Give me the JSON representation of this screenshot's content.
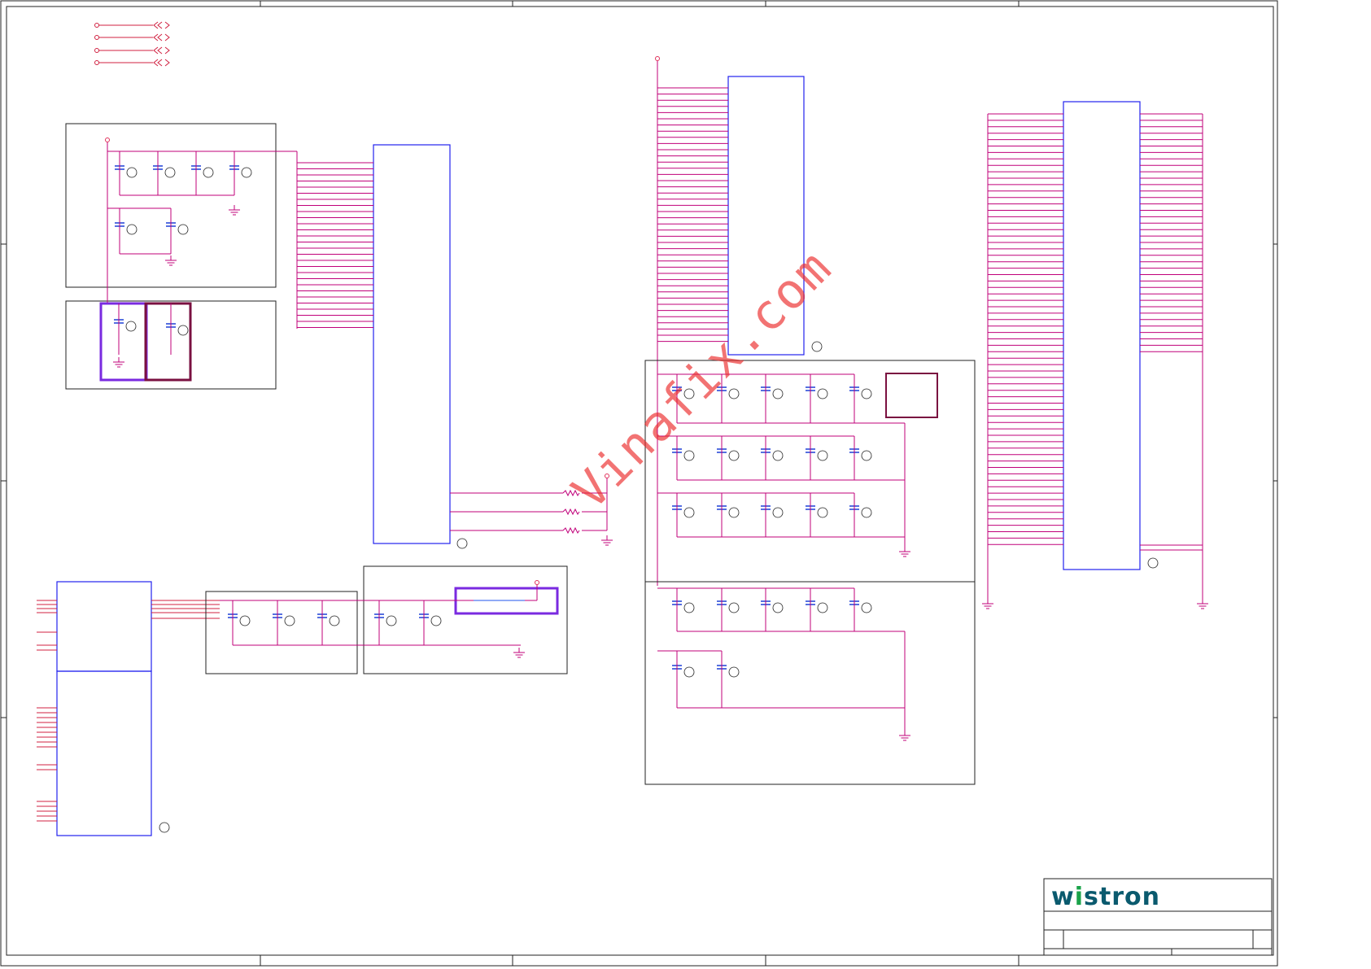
{
  "watermark": "Vinafix.com",
  "title_block": {
    "logo_pre": "w",
    "logo_i": "i",
    "logo_post": "stron"
  },
  "colors": {
    "wire": "#c0007a",
    "pin": "#e0305a",
    "chip": "#2222ee",
    "cap": "#1d3fd6",
    "border": "#222222"
  },
  "icons": [
    "gnd-symbol",
    "power-arrow",
    "resistor",
    "capacitor",
    "off-page-connector",
    "cp-tag"
  ]
}
